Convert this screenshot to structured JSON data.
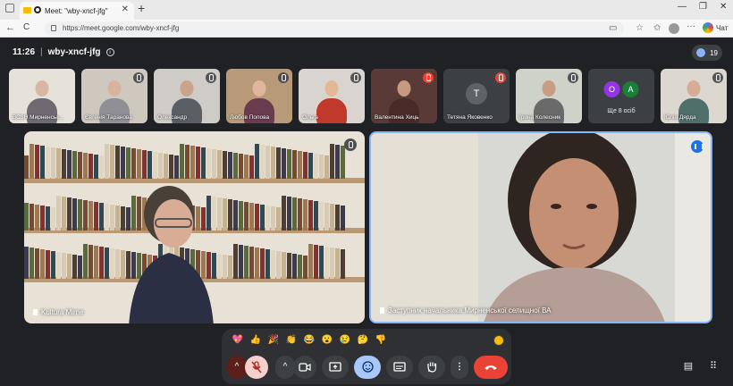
{
  "browser": {
    "tab_title": "Meet: \"wby-xncf-jfg\"",
    "tab_close": "✕",
    "new_tab": "+",
    "url": "https://meet.google.com/wby-xncf-jfg",
    "chat_label": "Чат",
    "back": "←",
    "reload": "C",
    "menu": "···",
    "min": "—",
    "max": "❐",
    "close": "✕"
  },
  "meeting": {
    "time": "11:26",
    "separator": "|",
    "code": "wby-xncf-jfg",
    "info": "i",
    "participant_count": "19"
  },
  "thumbnails": [
    {
      "name": "ВСЗН Мирненськ...",
      "muted": false,
      "bg": "#e6e1d9",
      "skin": "#d8b8a4",
      "shirt": "#6f6a72"
    },
    {
      "name": "Євгенія Таранова",
      "muted": true,
      "bg": "#cfc8bf",
      "skin": "#d8b49c",
      "shirt": "#8f8f95"
    },
    {
      "name": "Олександр",
      "muted": true,
      "bg": "#cfcbc6",
      "skin": "#c9a48a",
      "shirt": "#5a5f66"
    },
    {
      "name": "Любов Попова",
      "muted": true,
      "bg": "#b89a78",
      "skin": "#e0b79c",
      "shirt": "#6b3b4f"
    },
    {
      "name": "Ольга",
      "muted": true,
      "bg": "#d9d4cf",
      "skin": "#e2b899",
      "shirt": "#c0392b"
    },
    {
      "name": "Валентина Хиць",
      "muted": true,
      "bg": "#5a3a36",
      "skin": "#c79a80",
      "shirt": "#4a2a28",
      "red_mic": true
    },
    {
      "name": "Тетяна Яковенко",
      "muted": true,
      "letter": "Т",
      "letter_color": "#5f6368",
      "red_mic": true
    },
    {
      "name": "Ірина Колесник",
      "muted": true,
      "bg": "#cfd2c9",
      "skin": "#c99d84",
      "shirt": "#6a6a6a"
    },
    {
      "name": "Ще 8 осіб",
      "more": true,
      "letters": [
        {
          "l": "O",
          "c": "#9334e6"
        },
        {
          "l": "A",
          "c": "#188038"
        }
      ]
    },
    {
      "name": "Юлія Дярда",
      "muted": true,
      "bg": "#dcd7cf",
      "skin": "#d6ad94",
      "shirt": "#4f6f6a"
    }
  ],
  "main_tiles": [
    {
      "name": "Kultura Mirne",
      "muted": true
    },
    {
      "name": "Заступник начальника Мирненської селищної ВА",
      "speaking": true
    }
  ],
  "reactions": [
    "💖",
    "👍",
    "🎉",
    "👏",
    "😂",
    "😮",
    "😢",
    "🤔",
    "👎"
  ],
  "controls": {
    "mic_expand": "^",
    "cam_expand": "^",
    "more": "⋮"
  },
  "colors": {
    "meet_bg": "#202124",
    "accent": "#8ab4f8",
    "end_call": "#ea4335"
  }
}
